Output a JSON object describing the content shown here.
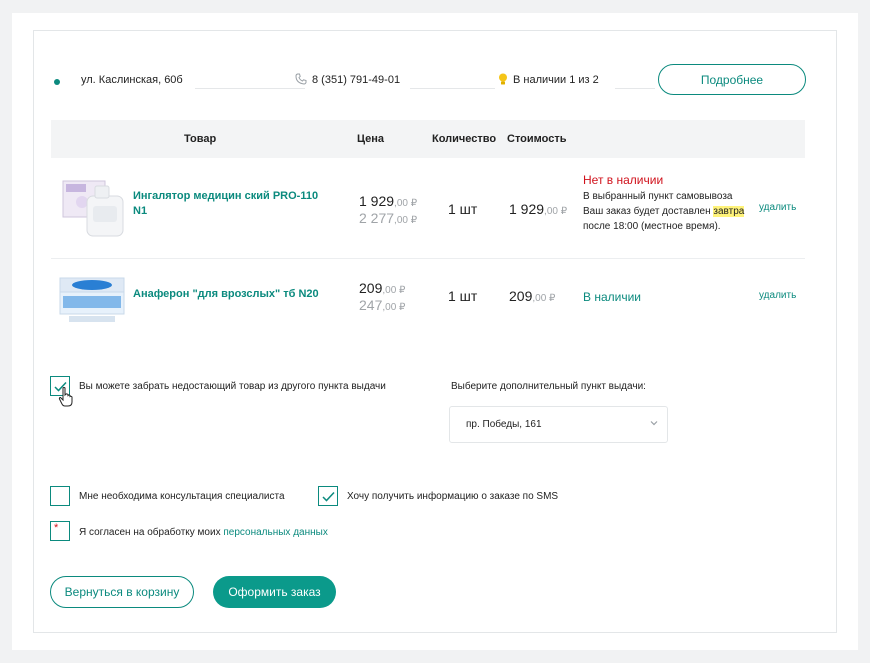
{
  "pickup": {
    "address": "ул. Каслинская, 60б",
    "phone": "8 (351) 791-49-01",
    "availability": "В наличии 1 из 2",
    "more_label": "Подробнее"
  },
  "table": {
    "headers": [
      "Товар",
      "Цена",
      "Количество",
      "Стоимость"
    ],
    "rows": [
      {
        "name": "Ингалятор медицин ский PRO-110 N1",
        "price_int": "1 929",
        "price_dec": ",00 ₽",
        "old_price_int": "2 277",
        "old_price_dec": ",00 ₽",
        "qty": "1 шт",
        "cost_int": "1 929",
        "cost_dec": ",00 ₽",
        "status": "Нет в наличии",
        "note_1": "В выбранный пункт самовывоза Ваш заказ будет доставлен",
        "note_hl": "завтра",
        "note_2": "после 18:00 (местное время).",
        "delete_label": "удалить"
      },
      {
        "name": "Анаферон \"для врозслых\" тб N20",
        "price_int": "209",
        "price_dec": ",00 ₽",
        "old_price_int": "247",
        "old_price_dec": ",00 ₽",
        "qty": "1 шт",
        "cost_int": "209",
        "cost_dec": ",00 ₽",
        "status": "В наличии",
        "delete_label": "удалить"
      }
    ]
  },
  "options": {
    "other_point_label": "Вы можете забрать недостающий товар из другого пункта выдачи",
    "other_point_checked": true,
    "choose_point_label": "Выберите дополнительный пункт выдачи:",
    "choose_point_value": "пр. Победы, 161",
    "consult_label": "Мне необходима консультация специалиста",
    "consult_checked": false,
    "sms_label": "Хочу получить информацию о заказе по SMS",
    "sms_checked": true,
    "consent_label": "Я согласен на обработку моих",
    "consent_link": "персональных данных",
    "consent_required_mark": "*"
  },
  "actions": {
    "back_label": "Вернуться в корзину",
    "order_label": "Оформить заказ"
  },
  "colors": {
    "accent": "#0b8a7e",
    "error": "#d0121c",
    "highlight": "#fff37a"
  }
}
